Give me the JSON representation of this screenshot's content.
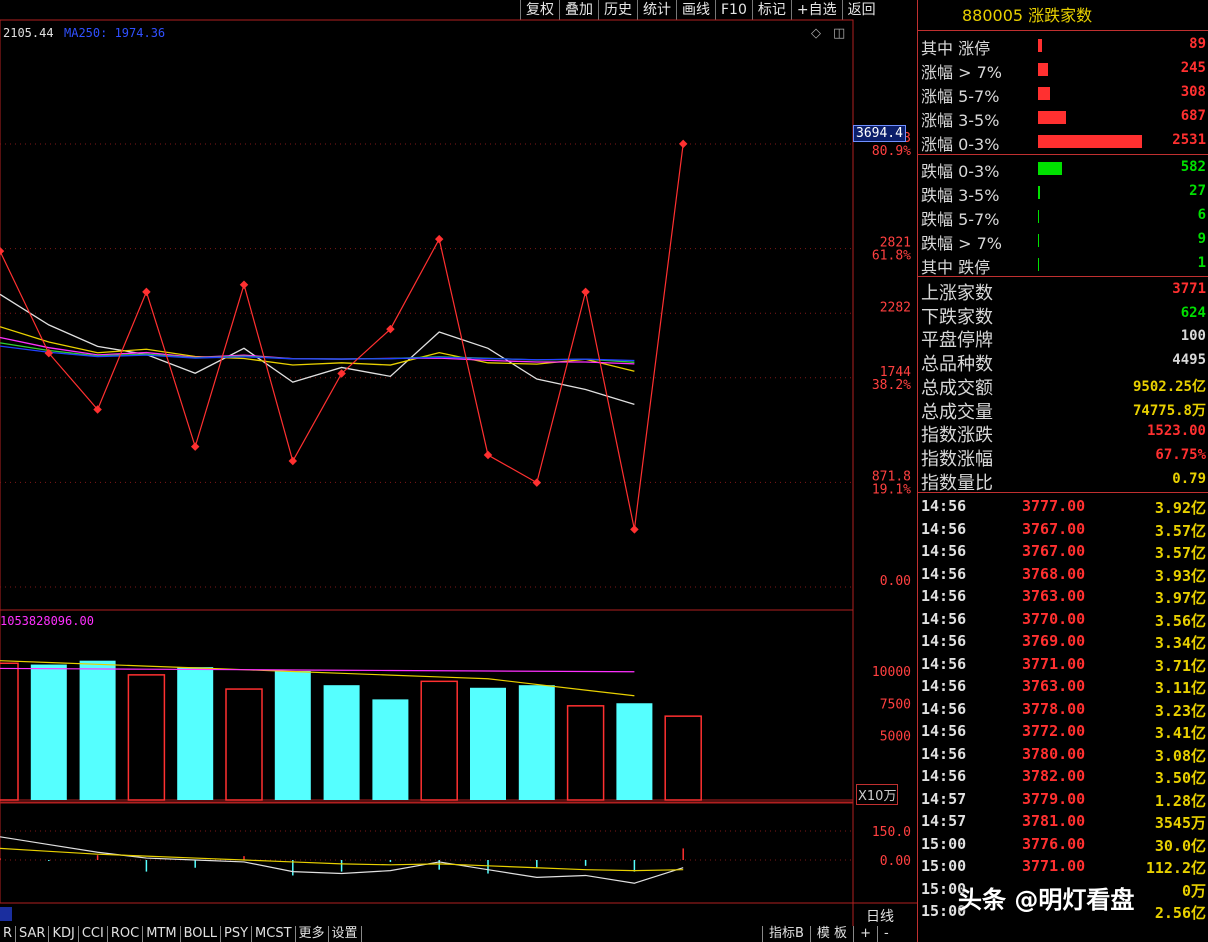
{
  "toolbar": [
    "复权",
    "叠加",
    "历史",
    "统计",
    "画线",
    "F10",
    "标记",
    "+自选",
    "返回"
  ],
  "legend": {
    "ma_first": "2105.44",
    "ma250_label": "MA250: 1974.36",
    "volume_legend": "1053828096.00"
  },
  "price_axis": [
    {
      "label": "3693",
      "pct": "80.9%",
      "value": 3693
    },
    {
      "label": "2821",
      "pct": "61.8%",
      "value": 2821
    },
    {
      "label": "2282",
      "pct": "",
      "value": 2282
    },
    {
      "label": "1744",
      "pct": "38.2%",
      "value": 1744
    },
    {
      "label": "871.8",
      "pct": "19.1%",
      "value": 871.8
    },
    {
      "label": "0.00",
      "pct": "",
      "value": 0
    }
  ],
  "current_price_tag": "3694.4",
  "volume_axis": [
    {
      "label": "10000",
      "value": 10000
    },
    {
      "label": "7500",
      "value": 7500
    },
    {
      "label": "5000",
      "value": 5000
    }
  ],
  "volume_unit": "X10万",
  "indicator_axis": [
    {
      "label": "150.0",
      "value": 150
    },
    {
      "label": "0.00",
      "value": 0
    }
  ],
  "period_label": "日线",
  "colors": {
    "up": "#ff3030",
    "down": "#00e000",
    "cyan": "#55ffff",
    "yellow": "#e8d000",
    "magenta": "#ff30ff",
    "blue": "#2040ff",
    "green": "#30d030",
    "white": "#e0e0e0"
  },
  "chart_data": {
    "type": "line",
    "price_series": [
      2800,
      1950,
      1480,
      2460,
      1170,
      2520,
      1050,
      1780,
      2150,
      2900,
      1100,
      870,
      2460,
      480,
      3694.4
    ],
    "volume_bars": [
      {
        "value": 10600,
        "up": true
      },
      {
        "value": 10500,
        "up": false
      },
      {
        "value": 10800,
        "up": false
      },
      {
        "value": 9700,
        "up": true
      },
      {
        "value": 10300,
        "up": false
      },
      {
        "value": 8600,
        "up": true
      },
      {
        "value": 10000,
        "up": false
      },
      {
        "value": 8900,
        "up": false
      },
      {
        "value": 7800,
        "up": false
      },
      {
        "value": 9200,
        "up": true
      },
      {
        "value": 8700,
        "up": false
      },
      {
        "value": 8900,
        "up": false
      },
      {
        "value": 7300,
        "up": true
      },
      {
        "value": 7500,
        "up": false
      },
      {
        "value": 6500,
        "up": true
      }
    ],
    "indicator_bars": [
      10,
      -5,
      25,
      -60,
      -40,
      20,
      -80,
      -60,
      -10,
      -50,
      -70,
      -40,
      -30,
      -60,
      60
    ]
  },
  "panel": {
    "title": "880005 涨跌家数",
    "breadth_up": [
      {
        "label": "其中 涨停",
        "value": "89",
        "bar": 4
      },
      {
        "label": "涨幅 > 7%",
        "value": "245",
        "bar": 10
      },
      {
        "label": "涨幅 5-7%",
        "value": "308",
        "bar": 12
      },
      {
        "label": "涨幅 3-5%",
        "value": "687",
        "bar": 28
      },
      {
        "label": "涨幅 0-3%",
        "value": "2531",
        "bar": 104
      }
    ],
    "breadth_down": [
      {
        "label": "跌幅 0-3%",
        "value": "582",
        "bar": 24
      },
      {
        "label": "跌幅 3-5%",
        "value": "27",
        "bar": 2
      },
      {
        "label": "跌幅 5-7%",
        "value": "6",
        "bar": 1
      },
      {
        "label": "跌幅 > 7%",
        "value": "9",
        "bar": 1
      },
      {
        "label": "其中 跌停",
        "value": "1",
        "bar": 1
      }
    ],
    "stats": [
      {
        "label": "上涨家数",
        "value": "3771",
        "color": "#ff3030"
      },
      {
        "label": "下跌家数",
        "value": "624",
        "color": "#00e000"
      },
      {
        "label": "平盘停牌",
        "value": "100",
        "color": "#d8d8d8"
      },
      {
        "label": "总品种数",
        "value": "4495",
        "color": "#d8d8d8"
      },
      {
        "label": "总成交额",
        "value": "9502.25亿",
        "color": "#e8d000"
      },
      {
        "label": "总成交量",
        "value": "74775.8万",
        "color": "#e8d000"
      },
      {
        "label": "指数涨跌",
        "value": "1523.00",
        "color": "#ff3030"
      },
      {
        "label": "指数涨幅",
        "value": "67.75%",
        "color": "#ff3030"
      },
      {
        "label": "指数量比",
        "value": "0.79",
        "color": "#e8d000"
      }
    ],
    "ticks": [
      {
        "time": "14:56",
        "price": "3777.00",
        "amount": "3.92亿"
      },
      {
        "time": "14:56",
        "price": "3767.00",
        "amount": "3.57亿"
      },
      {
        "time": "14:56",
        "price": "3767.00",
        "amount": "3.57亿"
      },
      {
        "time": "14:56",
        "price": "3768.00",
        "amount": "3.93亿"
      },
      {
        "time": "14:56",
        "price": "3763.00",
        "amount": "3.97亿"
      },
      {
        "time": "14:56",
        "price": "3770.00",
        "amount": "3.56亿"
      },
      {
        "time": "14:56",
        "price": "3769.00",
        "amount": "3.34亿"
      },
      {
        "time": "14:56",
        "price": "3771.00",
        "amount": "3.71亿"
      },
      {
        "time": "14:56",
        "price": "3763.00",
        "amount": "3.11亿"
      },
      {
        "time": "14:56",
        "price": "3778.00",
        "amount": "3.23亿"
      },
      {
        "time": "14:56",
        "price": "3772.00",
        "amount": "3.41亿"
      },
      {
        "time": "14:56",
        "price": "3780.00",
        "amount": "3.08亿"
      },
      {
        "time": "14:56",
        "price": "3782.00",
        "amount": "3.50亿"
      },
      {
        "time": "14:57",
        "price": "3779.00",
        "amount": "1.28亿"
      },
      {
        "time": "14:57",
        "price": "3781.00",
        "amount": "3545万"
      },
      {
        "time": "15:00",
        "price": "3776.00",
        "amount": "30.0亿"
      },
      {
        "time": "15:00",
        "price": "3771.00",
        "amount": "112.2亿"
      },
      {
        "time": "15:00",
        "price": "",
        "amount": "0万"
      },
      {
        "time": "15:00",
        "price": "",
        "amount": "2.56亿"
      }
    ]
  },
  "tabs": [
    "R",
    "SAR",
    "KDJ",
    "CCI",
    "ROC",
    "MTM",
    "BOLL",
    "PSY",
    "MCST",
    "更多",
    "设置"
  ],
  "tabs_right": [
    "指标B",
    "模 板",
    "+",
    "-"
  ],
  "watermark": "头条 @明灯看盘"
}
